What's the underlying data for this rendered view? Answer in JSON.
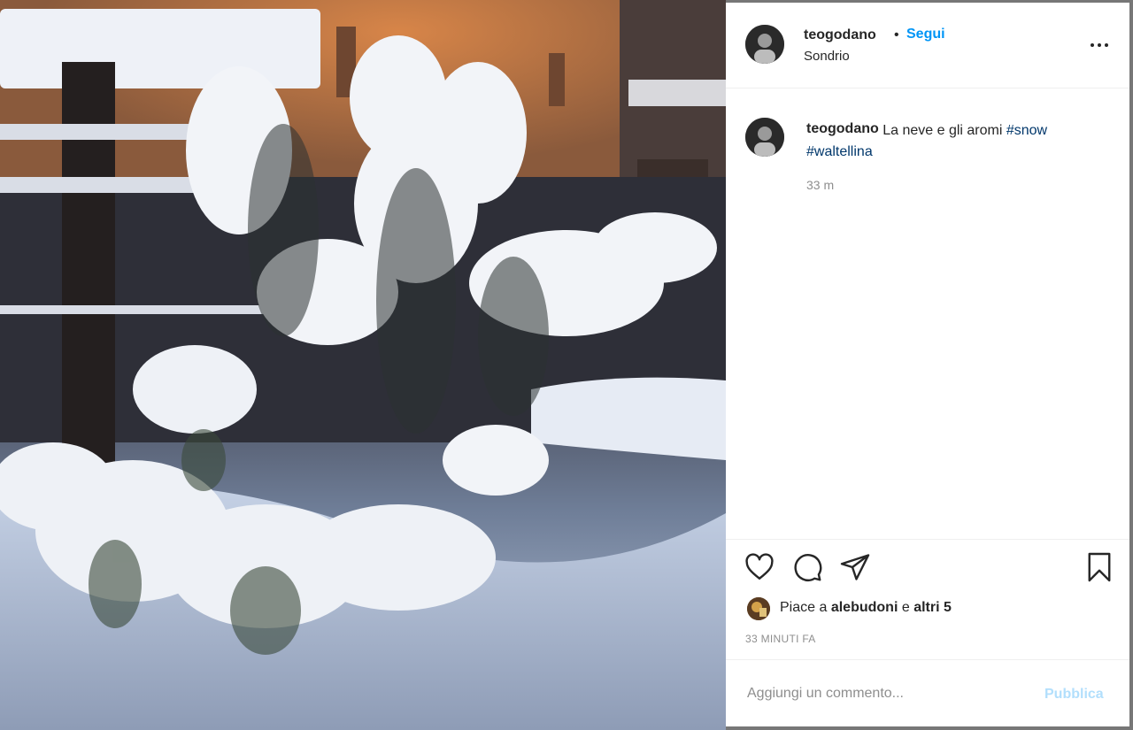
{
  "post": {
    "image_alt": "Cespuglio di rosmarino coperto di neve su un balcone",
    "image_icon": "snowy-plant-photo"
  },
  "header": {
    "username": "teogodano",
    "separator": "•",
    "follow_label": "Segui",
    "location": "Sondrio",
    "more_icon": "more-options-icon"
  },
  "caption": {
    "username": "teogodano",
    "text": "La neve e gli aromi",
    "hashtags": [
      "#snow",
      "#waltellina"
    ],
    "time": "33 m"
  },
  "actions": {
    "like_icon": "heart-icon",
    "comment_icon": "comment-icon",
    "share_icon": "paper-plane-icon",
    "save_icon": "bookmark-icon"
  },
  "likes": {
    "prefix": "Piace a",
    "user": "alebudoni",
    "middle": "e",
    "others": "altri 5"
  },
  "posted_ago": "33 MINUTI FA",
  "comment": {
    "placeholder": "Aggiungi un commento...",
    "publish_label": "Pubblica"
  },
  "colors": {
    "follow": "#0095f6",
    "hashtag": "#00376b",
    "publish_disabled": "#b2dffc",
    "muted": "#8e8e8e"
  }
}
